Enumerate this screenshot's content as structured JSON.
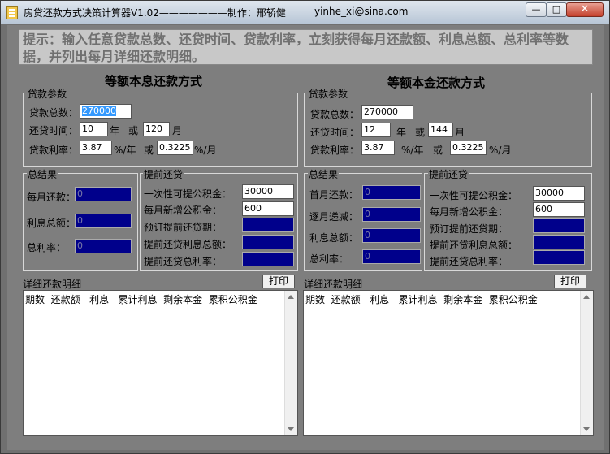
{
  "window": {
    "title": "房贷还款方式决策计算器V1.02———————制作：邢轿健",
    "email": "yinhe_xi@sina.com",
    "min_glyph": "—",
    "max_glyph": "□",
    "close_glyph": "✕"
  },
  "hint": "提示：输入任意贷款总数、还贷时间、贷款利率，立刻获得每月还款额、利息总额、总利率等数据，并列出每月详细还款明细。",
  "left": {
    "title": "等额本息还款方式",
    "loan_group": "贷款参数",
    "loan_total_label": "贷款总数：",
    "loan_total": "270000",
    "term_label": "还贷时间：",
    "term_years": "10",
    "year_unit": "年",
    "or1": "或",
    "term_months": "120",
    "month_unit": "月",
    "rate_label": "贷款利率：",
    "rate_year": "3.87",
    "rate_year_unit": "%/年",
    "or2": "或",
    "rate_month": "0.3225",
    "rate_month_unit": "%/月",
    "result_group": "总结果",
    "monthly_label": "每月还款：",
    "monthly_value": "0",
    "interest_label": "利息总额：",
    "interest_value": "0",
    "total_rate_label": "总利率：",
    "total_rate_value": "0",
    "prepay_group": "提前还贷",
    "fund_once_label": "一次性可提公积金：",
    "fund_once": "30000",
    "fund_monthly_label": "每月新增公积金：",
    "fund_monthly": "600",
    "prepay_period_label": "预订提前还贷期：",
    "prepay_interest_label": "提前还贷利息总额：",
    "prepay_rate_label": "提前还贷总利率：",
    "detail_label": "详细还款明细",
    "print_label": "打印",
    "list_header": "期数  还款额   利息   累计利息  剩余本金  累积公积金"
  },
  "right": {
    "title": "等额本金还款方式",
    "loan_group": "贷款参数",
    "loan_total_label": "贷款总数：",
    "loan_total": "270000",
    "term_label": "还贷时间：",
    "term_years": "12",
    "year_unit": "年",
    "or1": "或",
    "term_months": "144",
    "month_unit": "月",
    "rate_label": "贷款利率：",
    "rate_year": "3.87",
    "rate_year_unit": "%/年",
    "or2": "或",
    "rate_month": "0.3225",
    "rate_month_unit": "%/月",
    "result_group": "总结果",
    "first_month_label": "首月还款：",
    "first_month_value": "0",
    "decrease_label": "逐月递减：",
    "decrease_value": "0",
    "interest_label": "利息总额：",
    "interest_value": "0",
    "total_rate_label": "总利率：",
    "total_rate_value": "0",
    "prepay_group": "提前还贷",
    "fund_once_label": "一次性可提公积金：",
    "fund_once": "30000",
    "fund_monthly_label": "每月新增公积金：",
    "fund_monthly": "600",
    "prepay_period_label": "预订提前还贷期：",
    "prepay_interest_label": "提前还贷利息总额：",
    "prepay_rate_label": "提前还贷总利率：",
    "detail_label": "详细还款明细",
    "print_label": "打印",
    "list_header": "期数  还款额   利息   累计利息  剩余本金  累积公积金"
  },
  "colors": {
    "client_bg": "#7e7e7e",
    "output_bg": "#00008b",
    "selection": "#3399ff"
  }
}
